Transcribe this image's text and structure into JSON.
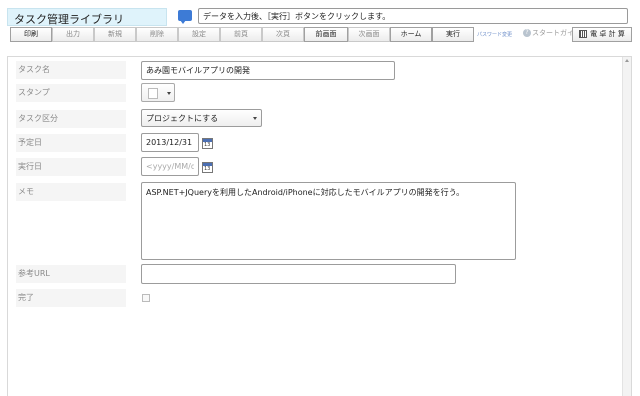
{
  "header": {
    "app_title": "タスク管理ライブラリ",
    "message": "データを入力後、［実行］ボタンをクリックします。",
    "message_icon": "speech-bubble-icon"
  },
  "toolbar": {
    "buttons": [
      {
        "label": "印刷",
        "enabled": true
      },
      {
        "label": "出力",
        "enabled": false
      },
      {
        "label": "新規",
        "enabled": false
      },
      {
        "label": "削除",
        "enabled": false
      },
      {
        "label": "設定",
        "enabled": false
      },
      {
        "label": "前頁",
        "enabled": false
      },
      {
        "label": "次頁",
        "enabled": false
      },
      {
        "label": "前画面",
        "enabled": true
      },
      {
        "label": "次画面",
        "enabled": false
      },
      {
        "label": "ホーム",
        "enabled": true
      },
      {
        "label": "実行",
        "enabled": true
      }
    ],
    "password_link": "パスワード変更",
    "guide_label": "スタートガイド",
    "guide_icon": "question-icon",
    "calculator_label": "電 卓 計 算",
    "calculator_icon": "calculator-icon"
  },
  "form": {
    "task_name": {
      "label": "タスク名",
      "value": "あみ園モバイルアプリの開発"
    },
    "stamp": {
      "label": "スタンプ",
      "icon": "stamp-square-icon"
    },
    "task_type": {
      "label": "タスク区分",
      "value": "プロジェクトにする"
    },
    "due_date": {
      "label": "予定日",
      "value": "2013/12/31",
      "calendar_icon_text": "13"
    },
    "done_date": {
      "label": "実行日",
      "value": "",
      "placeholder": "<yyyy/MM/d",
      "calendar_icon_text": "13"
    },
    "memo": {
      "label": "メモ",
      "value": "ASP.NET+JQueryを利用したAndroid/iPhoneに対応したモバイルアプリの開発を行う。"
    },
    "reference_url": {
      "label": "参考URL",
      "value": ""
    },
    "complete": {
      "label": "完了",
      "checked": false
    }
  },
  "colors": {
    "title_bg": "#dff3fb",
    "label_bg": "#f5f5f5",
    "accent": "#3d7bd6"
  }
}
